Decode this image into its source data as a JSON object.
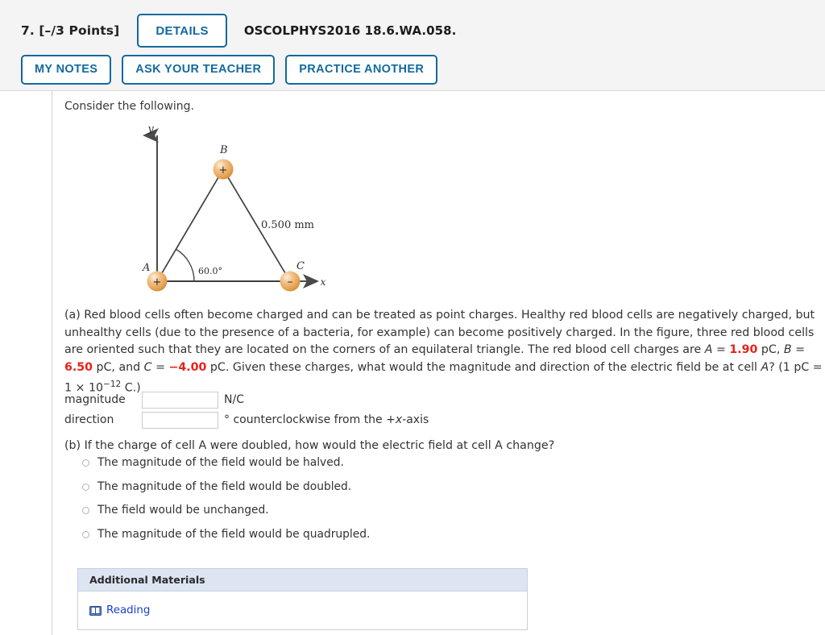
{
  "header": {
    "points_label": "7.  [–/3 Points]",
    "details_button": "DETAILS",
    "question_code": "OSCOLPHYS2016 18.6.WA.058.",
    "buttons": [
      {
        "label": "MY NOTES",
        "name": "my-notes-button"
      },
      {
        "label": "ASK YOUR TEACHER",
        "name": "ask-your-teacher-button"
      },
      {
        "label": "PRACTICE ANOTHER",
        "name": "practice-another-button"
      }
    ]
  },
  "body": {
    "consider": "Consider the following.",
    "part_a": {
      "prefix": "(a) Red blood cells often become charged and can be treated as point charges. Healthy red blood cells are negatively charged, but unhealthy cells (due to the presence of a bacteria, for example) can become positively charged. In the figure, three red blood cells are oriented such that they are located on the corners of an equilateral triangle. The red blood cell charges are ",
      "charge_a_name": "A",
      "charge_a_eq": " = ",
      "charge_a_value": "1.90",
      "charge_a_unit": " pC, ",
      "charge_b_name": "B",
      "charge_b_eq": " = ",
      "charge_b_value": "6.50",
      "charge_b_unit": " pC, and ",
      "charge_c_name": "C",
      "charge_c_eq": " = ",
      "charge_c_value": "−4.00",
      "charge_c_unit": " pC. ",
      "question": "Given these charges, what would the magnitude and direction of the electric field be at cell ",
      "cell_ref": "A",
      "question_tail": "? (1 pC = 1 ",
      "times": "×",
      "exp_base": " 10",
      "exp_power": "−12",
      "tail_end": " C.)"
    },
    "answers": {
      "magnitude_label": "magnitude",
      "magnitude_value": "",
      "magnitude_placeholder": "",
      "magnitude_unit": "N/C",
      "direction_label": "direction",
      "direction_value": "",
      "direction_placeholder": "",
      "direction_unit_prefix": "° counterclockwise from the +",
      "direction_unit_axis": "x",
      "direction_unit_suffix": "-axis"
    },
    "part_b": {
      "question": "(b) If the charge of cell A were doubled, how would the electric field at cell A change?",
      "options": [
        "The magnitude of the field would be halved.",
        "The magnitude of the field would be doubled.",
        "The field would be unchanged.",
        "The magnitude of the field would be quadrupled."
      ],
      "selected_index": -1
    }
  },
  "figure": {
    "y_axis_label": "y",
    "x_axis_label": "x",
    "vertex_a_label": "A",
    "vertex_a_sign": "+",
    "vertex_b_label": "B",
    "vertex_b_sign": "+",
    "vertex_c_label": "C",
    "vertex_c_sign": "–",
    "side_length_label": "0.500 mm",
    "angle_label": "60.0°",
    "sphere_color": "#e7a557",
    "sphere_highlight": "#fbe6c8"
  },
  "additional_materials": {
    "title": "Additional Materials",
    "reading_label": "Reading"
  },
  "colors": {
    "accent_blue": "#13699e",
    "value_red": "#e8221b",
    "link_blue": "#1a3fcf",
    "panel_bg": "#f4f4f4",
    "am_header_bg": "#dde4f2"
  }
}
